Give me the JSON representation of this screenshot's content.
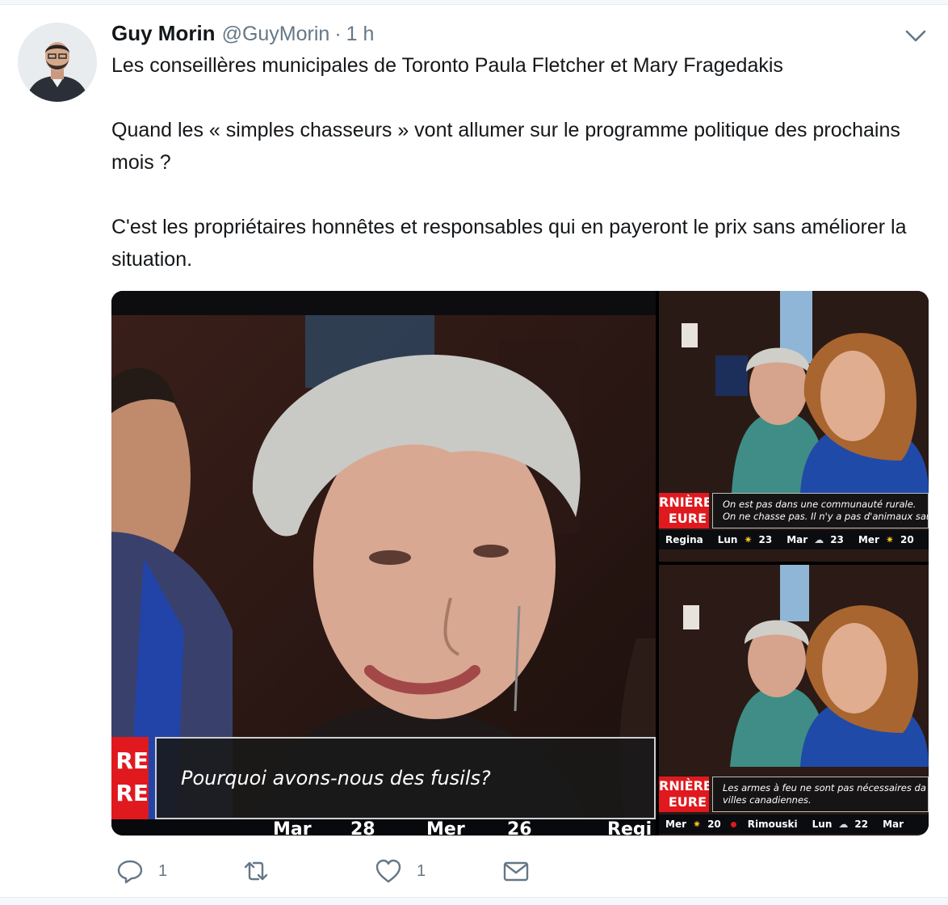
{
  "tweet": {
    "author_name": "Guy Morin",
    "handle": "@GuyMorin",
    "separator": "·",
    "time": "1 h",
    "paragraphs": [
      "Les conseillères municipales de Toronto Paula Fletcher et Mary Fragedakis",
      "Quand les « simples chasseurs » vont allumer sur le programme politique des prochains mois ?",
      "C'est les propriétaires honnêtes et responsables qui en payeront le prix sans améliorer la situation."
    ]
  },
  "media": {
    "main": {
      "caption": "Pourquoi avons-nous des fusils?",
      "brand": [
        "RE",
        "RE"
      ],
      "ticker": [
        "Mar",
        "28",
        "Mer",
        "26",
        "Regi"
      ]
    },
    "top_right": {
      "brand": [
        "RNIÈRE",
        "EURE"
      ],
      "caption": [
        "On est pas dans une communauté rurale.",
        "On ne chasse pas. Il n'y a pas d'animaux sau"
      ],
      "ticker": [
        "Regina",
        "Lun",
        "23",
        "Mar",
        "23",
        "Mer",
        "20"
      ]
    },
    "bottom_right": {
      "brand": [
        "RNIÈRE",
        "EURE"
      ],
      "caption": [
        "Les armes à feu ne sont pas nécessaires da",
        "villes canadiennes."
      ],
      "ticker": [
        "Mer",
        "20",
        "Rimouski",
        "Lun",
        "22",
        "Mar"
      ]
    }
  },
  "actions": {
    "reply_count": "1",
    "retweet_count": "",
    "like_count": "1"
  },
  "icons": {
    "caret": "chevron-down-icon",
    "reply": "reply-icon",
    "retweet": "retweet-icon",
    "like": "heart-icon",
    "dm": "envelope-icon"
  },
  "colors": {
    "text": "#14171a",
    "muted": "#657786",
    "brand_red": "#e0191f"
  }
}
